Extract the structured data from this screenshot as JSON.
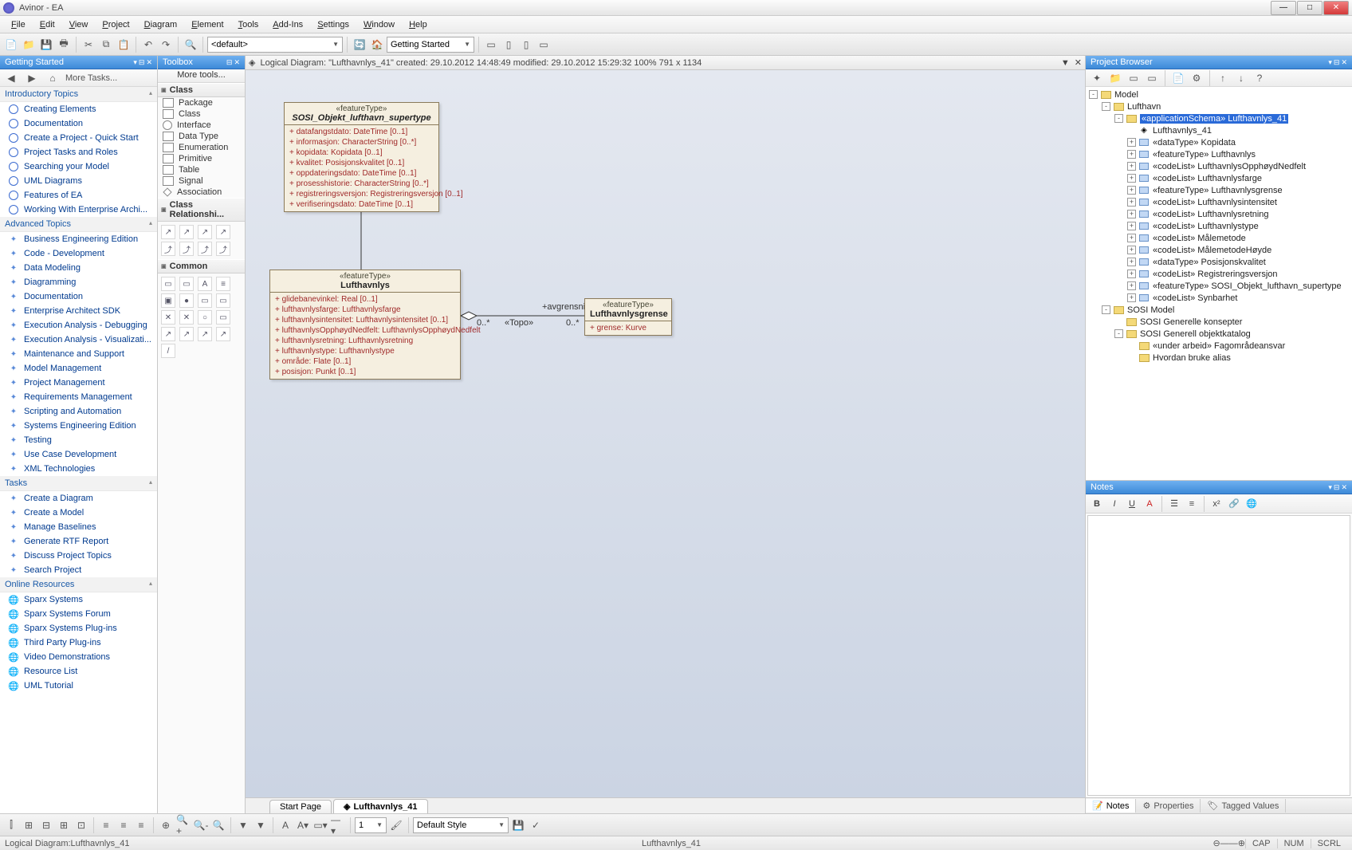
{
  "title": "Avinor - EA",
  "menus": [
    "File",
    "Edit",
    "View",
    "Project",
    "Diagram",
    "Element",
    "Tools",
    "Add-Ins",
    "Settings",
    "Window",
    "Help"
  ],
  "toolbar": {
    "default_dropdown": "<default>",
    "getting_started_dropdown": "Getting Started"
  },
  "getting_started": {
    "title": "Getting Started",
    "more_tasks": "More Tasks...",
    "sections": [
      {
        "title": "Introductory Topics",
        "icon": "circ",
        "items": [
          "Creating Elements",
          "Documentation",
          "Create a Project - Quick Start",
          "Project Tasks and Roles",
          "Searching your Model",
          "UML Diagrams",
          "Features of EA",
          "Working With Enterprise Archi..."
        ]
      },
      {
        "title": "Advanced Topics",
        "icon": "star",
        "items": [
          "Business Engineering Edition",
          "Code - Development",
          "Data Modeling",
          "Diagramming",
          "Documentation",
          "Enterprise Architect SDK",
          "Execution Analysis - Debugging",
          "Execution Analysis - Visualizati...",
          "Maintenance and Support",
          "Model Management",
          "Project Management",
          "Requirements Management",
          "Scripting and Automation",
          "Systems Engineering Edition",
          "Testing",
          "Use Case Development",
          "XML Technologies"
        ]
      },
      {
        "title": "Tasks",
        "icon": "star",
        "items": [
          "Create a Diagram",
          "Create a Model",
          "Manage Baselines",
          "Generate RTF Report",
          "Discuss Project Topics",
          "Search Project"
        ]
      },
      {
        "title": "Online Resources",
        "icon": "globe",
        "items": [
          "Sparx Systems",
          "Sparx Systems Forum",
          "Sparx Systems Plug-ins",
          "Third Party Plug-ins",
          "Video Demonstrations",
          "Resource List",
          "UML Tutorial"
        ]
      }
    ]
  },
  "toolbox": {
    "title": "Toolbox",
    "more_tools": "More tools...",
    "class_section": "Class",
    "class_items": [
      "Package",
      "Class",
      "Interface",
      "Data Type",
      "Enumeration",
      "Primitive",
      "Table",
      "Signal",
      "Association"
    ],
    "rel_section": "Class Relationshi...",
    "common_section": "Common"
  },
  "diagram": {
    "header": "Logical Diagram: \"Lufthavnlys_41\"  created: 29.10.2012 14:48:49 modified: 29.10.2012 15:29:32   100%   791 x 1134",
    "box1": {
      "stereo": "«featureType»",
      "name": "SOSI_Objekt_lufthavn_supertype",
      "attrs": [
        "datafangstdato:  DateTime [0..1]",
        "informasjon:  CharacterString [0..*]",
        "kopidata:  Kopidata [0..1]",
        "kvalitet:  Posisjonskvalitet [0..1]",
        "oppdateringsdato:  DateTime [0..1]",
        "prosesshistorie:  CharacterString [0..*]",
        "registreringsversjon:  Registreringsversjon [0..1]",
        "verifiseringsdato:  DateTime [0..1]"
      ]
    },
    "box2": {
      "stereo": "«featureType»",
      "name": "Lufthavnlys",
      "attrs": [
        "glidebanevinkel:  Real [0..1]",
        "lufthavnlysfarge:  Lufthavnlysfarge",
        "lufthavnlysintensitet:  Lufthavnlysintensitet [0..1]",
        "lufthavnlysOpphøydNedfelt:  LufthavnlysOpphøydNedfelt",
        "lufthavnlysretning:  Lufthavnlysretning",
        "lufthavnlystype:  Lufthavnlystype",
        "område:  Flate [0..1]",
        "posisjon:  Punkt [0..1]"
      ]
    },
    "box3": {
      "stereo": "«featureType»",
      "name": "Lufthavnlysgrense",
      "attrs": [
        "grense:  Kurve"
      ]
    },
    "link_label": "+avgrensning",
    "link_stereo": "«Topo»",
    "mult_left": "0..*",
    "mult_right": "0..*",
    "tabs": {
      "start": "Start Page",
      "current": "Lufthavnlys_41"
    }
  },
  "project_browser": {
    "title": "Project Browser",
    "tree": [
      {
        "d": 0,
        "exp": "-",
        "icon": "fold",
        "label": "Model"
      },
      {
        "d": 1,
        "exp": "-",
        "icon": "pkg",
        "label": "Lufthavn"
      },
      {
        "d": 2,
        "exp": "-",
        "icon": "pkg",
        "label": "«applicationSchema» Lufthavnlys_41",
        "sel": true
      },
      {
        "d": 3,
        "exp": "",
        "icon": "diag",
        "label": "Lufthavnlys_41"
      },
      {
        "d": 3,
        "exp": "+",
        "icon": "cls",
        "label": "«dataType» Kopidata"
      },
      {
        "d": 3,
        "exp": "+",
        "icon": "cls",
        "label": "«featureType» Lufthavnlys"
      },
      {
        "d": 3,
        "exp": "+",
        "icon": "cls",
        "label": "«codeList» LufthavnlysOpphøydNedfelt"
      },
      {
        "d": 3,
        "exp": "+",
        "icon": "cls",
        "label": "«codeList» Lufthavnlysfarge"
      },
      {
        "d": 3,
        "exp": "+",
        "icon": "cls",
        "label": "«featureType» Lufthavnlysgrense"
      },
      {
        "d": 3,
        "exp": "+",
        "icon": "cls",
        "label": "«codeList» Lufthavnlysintensitet"
      },
      {
        "d": 3,
        "exp": "+",
        "icon": "cls",
        "label": "«codeList» Lufthavnlysretning"
      },
      {
        "d": 3,
        "exp": "+",
        "icon": "cls",
        "label": "«codeList» Lufthavnlystype"
      },
      {
        "d": 3,
        "exp": "+",
        "icon": "cls",
        "label": "«codeList» Målemetode"
      },
      {
        "d": 3,
        "exp": "+",
        "icon": "cls",
        "label": "«codeList» MålemetodeHøyde"
      },
      {
        "d": 3,
        "exp": "+",
        "icon": "cls",
        "label": "«dataType» Posisjonskvalitet"
      },
      {
        "d": 3,
        "exp": "+",
        "icon": "cls",
        "label": "«codeList» Registreringsversjon"
      },
      {
        "d": 3,
        "exp": "+",
        "icon": "cls",
        "label": "«featureType» SOSI_Objekt_lufthavn_supertype"
      },
      {
        "d": 3,
        "exp": "+",
        "icon": "cls",
        "label": "«codeList» Synbarhet"
      },
      {
        "d": 1,
        "exp": "-",
        "icon": "pkg",
        "label": "SOSI Model"
      },
      {
        "d": 2,
        "exp": "",
        "icon": "pkg",
        "label": "SOSI Generelle konsepter"
      },
      {
        "d": 2,
        "exp": "-",
        "icon": "pkg",
        "label": "SOSI Generell objektkatalog"
      },
      {
        "d": 3,
        "exp": "",
        "icon": "pkg",
        "label": "«under arbeid» Fagområdeansvar"
      },
      {
        "d": 3,
        "exp": "",
        "icon": "pkg",
        "label": "Hvordan bruke alias"
      }
    ]
  },
  "notes": {
    "title": "Notes",
    "tabs": [
      "Notes",
      "Properties",
      "Tagged Values"
    ]
  },
  "bottom_toolbar": {
    "style_dropdown": "Default Style",
    "number": "1"
  },
  "status": {
    "left": "Logical Diagram:Lufthavnlys_41",
    "center": "Lufthavnlys_41",
    "cap": "CAP",
    "num": "NUM",
    "scrl": "SCRL"
  }
}
